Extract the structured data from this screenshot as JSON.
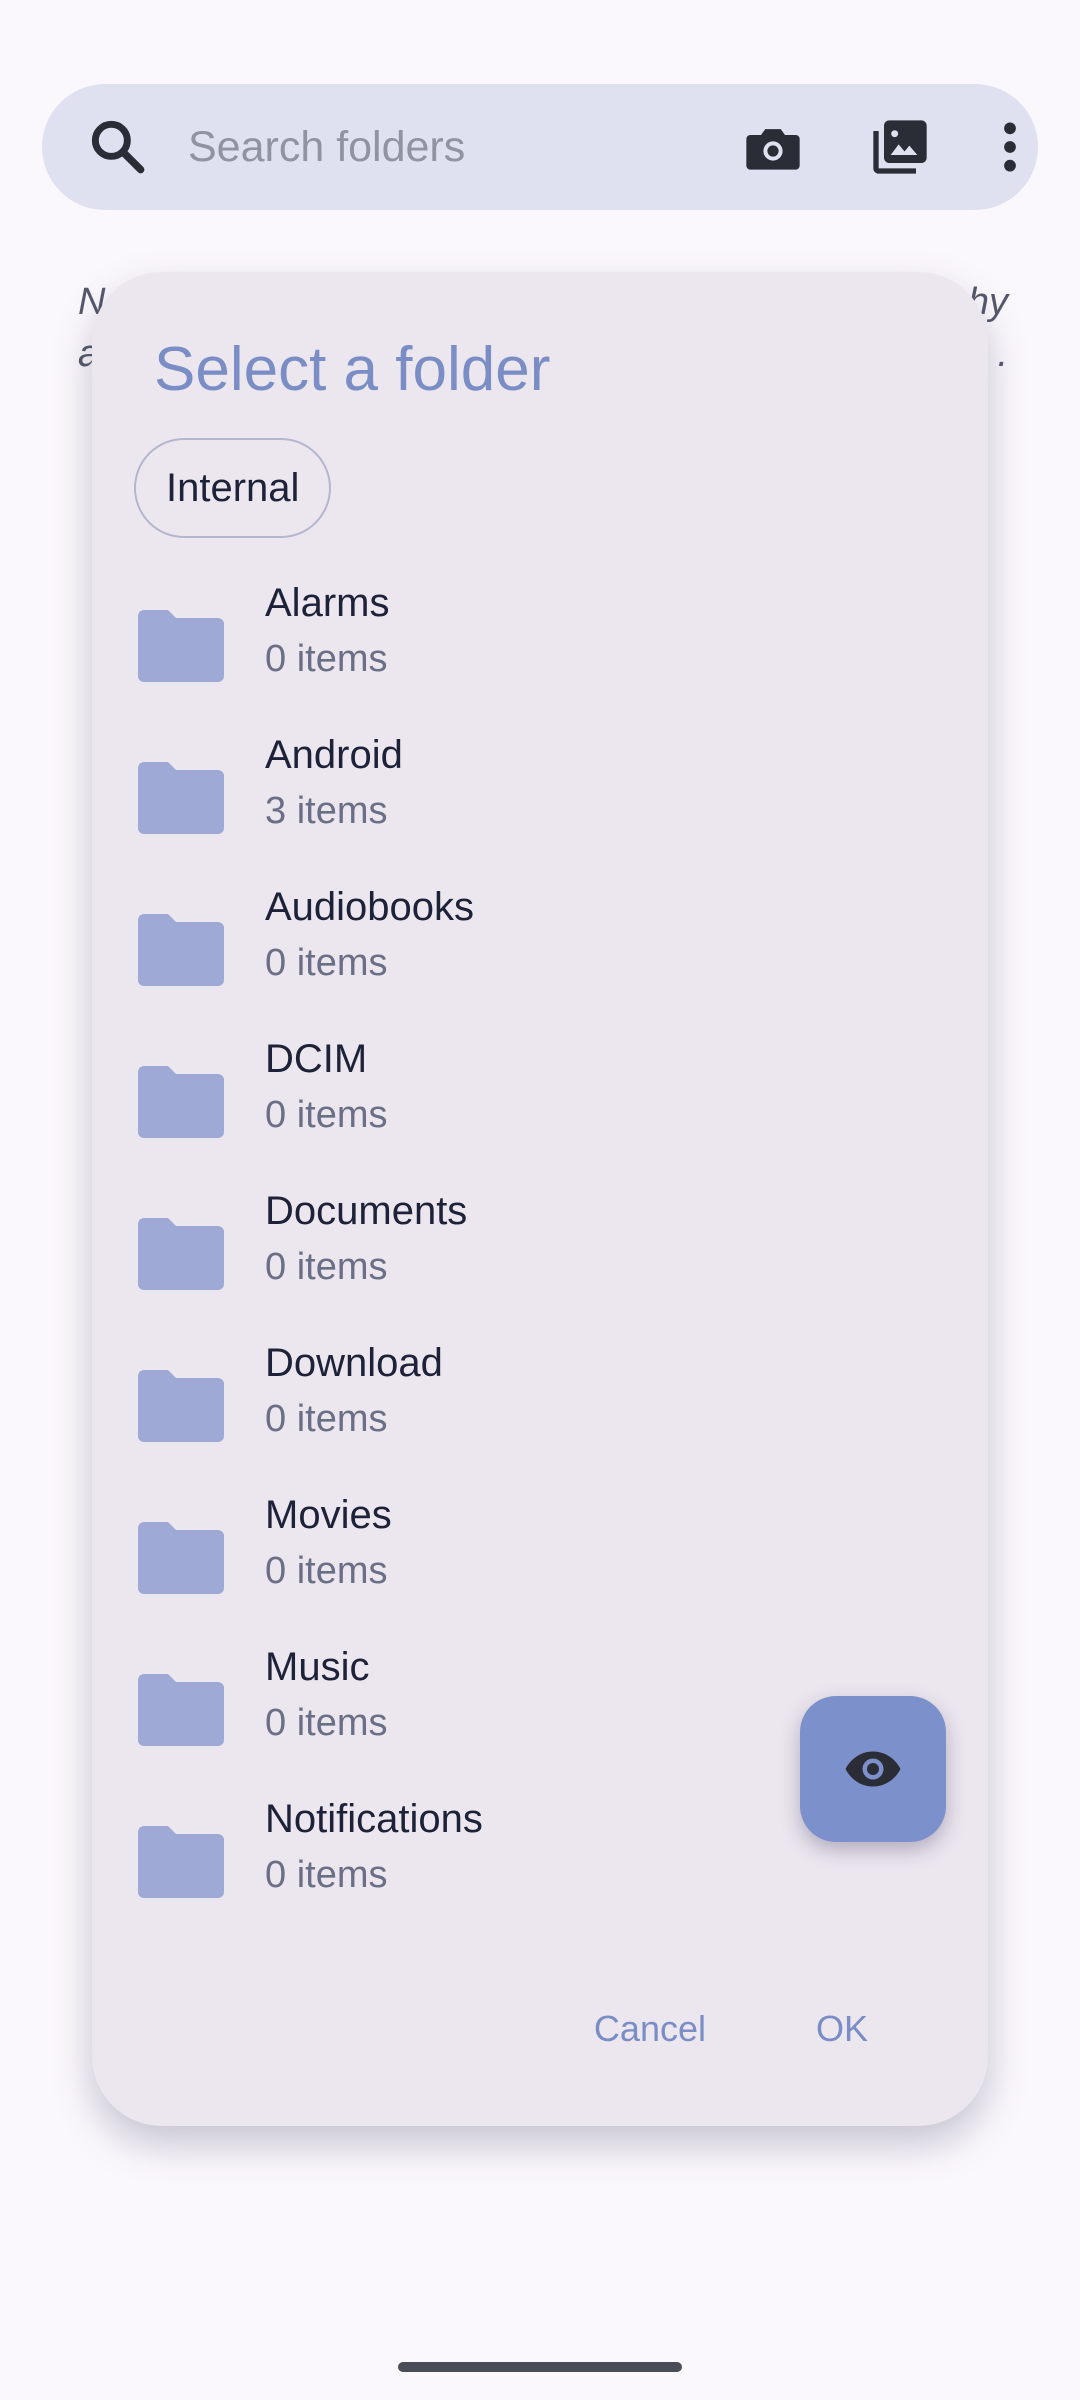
{
  "search": {
    "placeholder": "Search folders",
    "icons": [
      "search-icon",
      "camera-icon",
      "gallery-icon",
      "more-vert-icon"
    ]
  },
  "background_text": {
    "line1_start": "N",
    "line1_end": "hy",
    "line2_start": "a",
    "line2_end": "."
  },
  "dialog": {
    "title": "Select a folder",
    "storage_chip": "Internal",
    "folders": [
      {
        "name": "Alarms",
        "count": "0 items"
      },
      {
        "name": "Android",
        "count": "3 items"
      },
      {
        "name": "Audiobooks",
        "count": "0 items"
      },
      {
        "name": "DCIM",
        "count": "0 items"
      },
      {
        "name": "Documents",
        "count": "0 items"
      },
      {
        "name": "Download",
        "count": "0 items"
      },
      {
        "name": "Movies",
        "count": "0 items"
      },
      {
        "name": "Music",
        "count": "0 items"
      },
      {
        "name": "Notifications",
        "count": "0 items"
      }
    ],
    "fab_icon": "eye-icon",
    "cancel_label": "Cancel",
    "ok_label": "OK"
  },
  "colors": {
    "background": "#fbf8fd",
    "search_bar": "#dfe1f0",
    "dialog": "#ece6ef",
    "accent": "#7a8dc5",
    "folder_icon": "#9ea9d6",
    "fab": "#7c90cc"
  }
}
